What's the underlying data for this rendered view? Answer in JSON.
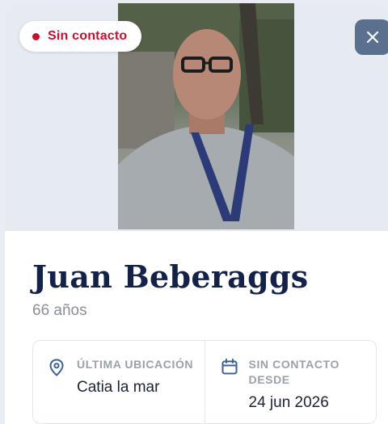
{
  "status": {
    "label": "Sin contacto",
    "color": "#c8102e"
  },
  "close": {
    "icon": "close-icon"
  },
  "person": {
    "name": "Juan Beberaggs",
    "age": "66 años"
  },
  "details": [
    {
      "icon": "location-pin-icon",
      "label": "ÚLTIMA UBICACIÓN",
      "value": "Catia la mar"
    },
    {
      "icon": "calendar-icon",
      "label": "SIN CONTACTO DESDE",
      "value": "24 jun 2026"
    }
  ],
  "colors": {
    "accent": "#5b6f8e",
    "name": "#14224a"
  }
}
